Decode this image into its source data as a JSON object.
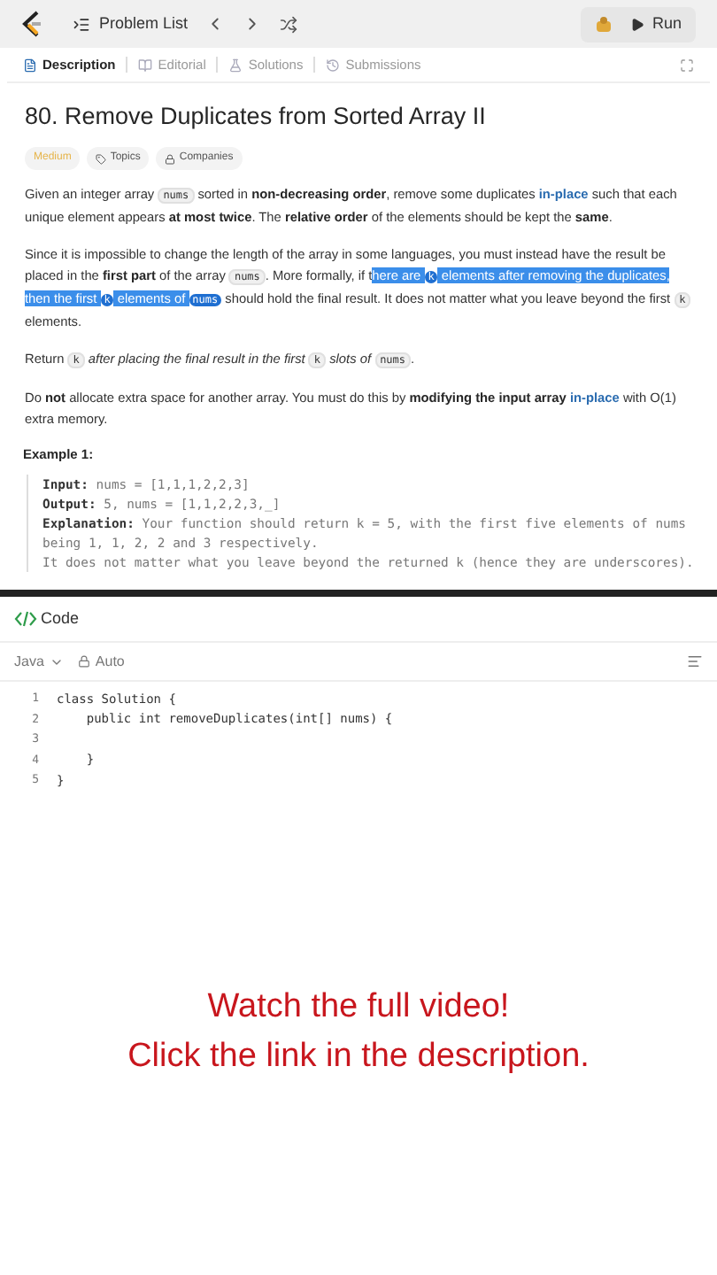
{
  "top_bar": {
    "problem_list": "Problem List",
    "run": "Run"
  },
  "tabs": [
    {
      "label": "Description",
      "selected": true
    },
    {
      "label": "Editorial",
      "selected": false
    },
    {
      "label": "Solutions",
      "selected": false
    },
    {
      "label": "Submissions",
      "selected": false
    }
  ],
  "title": "80. Remove Duplicates from Sorted Array II",
  "tags": [
    {
      "kind": "difficulty",
      "label": "Medium"
    },
    {
      "kind": "topics",
      "label": "Topics"
    },
    {
      "kind": "companies",
      "label": "Companies"
    }
  ],
  "paragraphs": [
    [
      {
        "kind": "text",
        "text": "Given an integer array "
      },
      {
        "kind": "code",
        "text": "nums"
      },
      {
        "kind": "text",
        "text": " sorted in "
      },
      {
        "kind": "bold",
        "text": "non-decreasing order"
      },
      {
        "kind": "text",
        "text": ", remove some duplicates "
      },
      {
        "kind": "link",
        "text": "in-place"
      },
      {
        "kind": "text",
        "text": " such that each unique element appears "
      },
      {
        "kind": "bold",
        "text": "at most twice"
      },
      {
        "kind": "text",
        "text": ". The "
      },
      {
        "kind": "bold",
        "text": "relative order"
      },
      {
        "kind": "text",
        "text": " of the elements should be kept the "
      },
      {
        "kind": "bold",
        "text": "same"
      },
      {
        "kind": "text",
        "text": "."
      }
    ],
    [
      {
        "kind": "text",
        "text": "Since it is impossible to change the length of the array in some languages, you must instead have the result be placed in the "
      },
      {
        "kind": "bold",
        "text": "first part"
      },
      {
        "kind": "text",
        "text": " of the array "
      },
      {
        "kind": "code",
        "text": "nums"
      },
      {
        "kind": "text",
        "text": ". More formally, if t"
      },
      {
        "kind": "text",
        "text": "here are ",
        "highlighted": true
      },
      {
        "kind": "code",
        "text": "k",
        "highlighted": true
      },
      {
        "kind": "text",
        "text": " elements after removing the duplicates, then the first ",
        "highlighted": true
      },
      {
        "kind": "code",
        "text": "k",
        "highlighted": true
      },
      {
        "kind": "text",
        "text": " elements of ",
        "highlighted": true
      },
      {
        "kind": "code",
        "text": "nums",
        "highlighted": true
      },
      {
        "kind": "text",
        "text": " should hold the final result. It does not matter what you leave beyond the first "
      },
      {
        "kind": "code",
        "text": "k"
      },
      {
        "kind": "text",
        "text": " elements."
      }
    ],
    [
      {
        "kind": "text",
        "text": "Return "
      },
      {
        "kind": "code",
        "text": "k"
      },
      {
        "kind": "italic",
        "text": " after placing the final result in the first "
      },
      {
        "kind": "code",
        "text": "k"
      },
      {
        "kind": "italic",
        "text": " slots of "
      },
      {
        "kind": "code",
        "text": "nums"
      },
      {
        "kind": "text",
        "text": "."
      }
    ],
    [
      {
        "kind": "text",
        "text": "Do "
      },
      {
        "kind": "bold",
        "text": "not"
      },
      {
        "kind": "text",
        "text": " allocate extra space for another array. You must do this by "
      },
      {
        "kind": "bold",
        "text": "modifying the input array "
      },
      {
        "kind": "link",
        "text": "in-place"
      },
      {
        "kind": "text",
        "text": " with O(1) extra memory."
      }
    ]
  ],
  "example": {
    "title": "Example 1:",
    "lines": [
      {
        "label": "Input:",
        "text": " nums = [1,1,1,2,2,3]"
      },
      {
        "label": "Output:",
        "text": " 5, nums = [1,1,2,2,3,_]"
      },
      {
        "label": "Explanation:",
        "text": " Your function should return k = 5, with the first five elements of nums being 1, 1, 2, 2 and 3 respectively."
      },
      {
        "text": "It does not matter what you leave beyond the returned k (hence they are underscores)."
      }
    ]
  },
  "code_panel": {
    "title": "Code",
    "language": "Java",
    "mode": "Auto",
    "lines": [
      {
        "number": "1",
        "text": "class Solution {"
      },
      {
        "number": "2",
        "text": "    public int removeDuplicates(int[] nums) {"
      },
      {
        "number": "3"
      },
      {
        "number": "4",
        "text": "    }"
      },
      {
        "number": "5",
        "text": "}"
      }
    ]
  },
  "overlay": [
    "Watch the full video!",
    "Click the link in the description."
  ]
}
